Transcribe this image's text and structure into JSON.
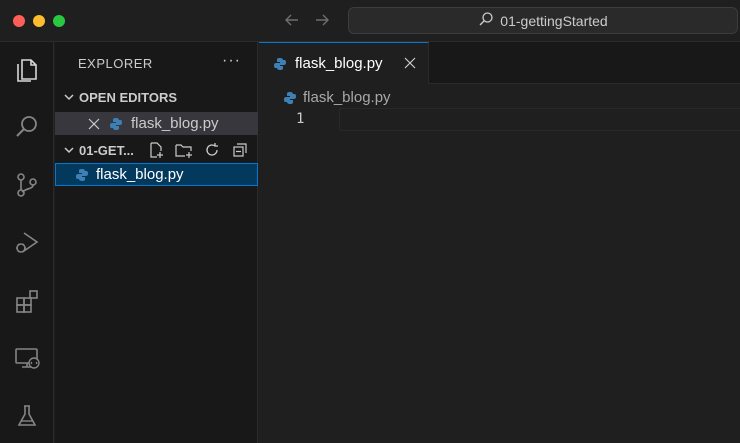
{
  "titlebar": {
    "search_text": "01-gettingStarted"
  },
  "activity": {
    "items": [
      "explorer-icon",
      "search-icon",
      "source-control-icon",
      "run-debug-icon",
      "extensions-icon",
      "remote-explorer-icon",
      "testing-icon"
    ]
  },
  "explorer": {
    "header": "EXPLORER",
    "more": "···",
    "open_editors": {
      "label": "OPEN EDITORS",
      "files": [
        {
          "name": "flask_blog.py"
        }
      ]
    },
    "folder": {
      "label": "01-GET...",
      "files": [
        {
          "name": "flask_blog.py"
        }
      ]
    }
  },
  "editor": {
    "tabs": [
      {
        "label": "flask_blog.py",
        "active": true
      }
    ],
    "breadcrumb": "flask_blog.py",
    "line_numbers": [
      "1"
    ]
  },
  "colors": {
    "accent": "#0078d4",
    "python_icon": "#3e7fb4"
  }
}
